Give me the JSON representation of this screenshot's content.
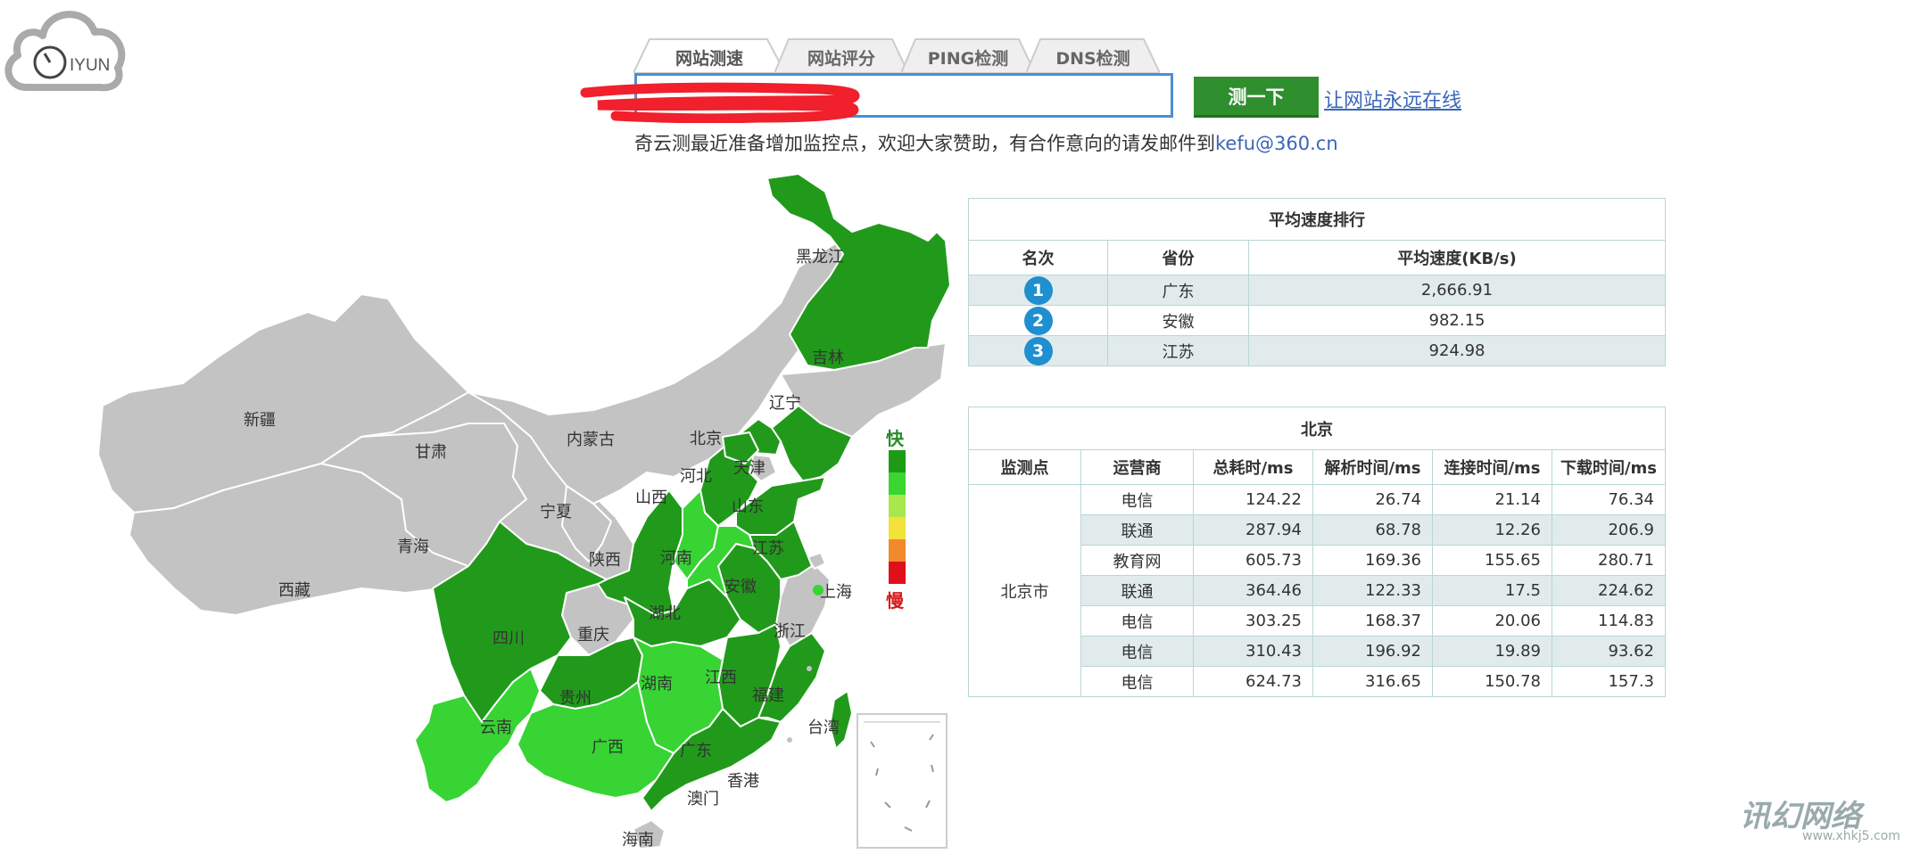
{
  "logo": {
    "text": "IYUN"
  },
  "tabs": [
    {
      "label": "网站测速",
      "active": true
    },
    {
      "label": "网站评分",
      "active": false
    },
    {
      "label": "PING检测",
      "active": false
    },
    {
      "label": "DNS检测",
      "active": false
    }
  ],
  "search": {
    "value": "",
    "redacted": true
  },
  "test_button": "测一下",
  "online_link": "让网站永远在线",
  "notice": {
    "text": "奇云测最近准备增加监控点，欢迎大家赞助，有合作意向的请发邮件到",
    "email": "kefu@360.cn"
  },
  "legend": {
    "fast": "快",
    "slow": "慢",
    "colors": [
      "#1e9b14",
      "#39d631",
      "#a8e84c",
      "#f2e23a",
      "#f08a2a",
      "#e0101a"
    ]
  },
  "colors": {
    "dark_green": "#219a1b",
    "light_green": "#37d434",
    "no_data": "#c3c3c3",
    "accent_blue": "#1f8fcf"
  },
  "map": {
    "provinces": [
      {
        "name": "新疆",
        "level": "none"
      },
      {
        "name": "西藏",
        "level": "none"
      },
      {
        "name": "青海",
        "level": "none"
      },
      {
        "name": "甘肃",
        "level": "none"
      },
      {
        "name": "内蒙古",
        "level": "none"
      },
      {
        "name": "宁夏",
        "level": "none"
      },
      {
        "name": "吉林",
        "level": "none"
      },
      {
        "name": "天津",
        "level": "none"
      },
      {
        "name": "重庆",
        "level": "none"
      },
      {
        "name": "浙江",
        "level": "none"
      },
      {
        "name": "上海",
        "level": "none"
      },
      {
        "name": "香港",
        "level": "none"
      },
      {
        "name": "澳门",
        "level": "none"
      },
      {
        "name": "海南",
        "level": "none"
      },
      {
        "name": "黑龙江",
        "level": "dark"
      },
      {
        "name": "辽宁",
        "level": "dark"
      },
      {
        "name": "北京",
        "level": "dark"
      },
      {
        "name": "河北",
        "level": "dark"
      },
      {
        "name": "山东",
        "level": "dark"
      },
      {
        "name": "江苏",
        "level": "dark"
      },
      {
        "name": "安徽",
        "level": "dark"
      },
      {
        "name": "陕西",
        "level": "dark"
      },
      {
        "name": "湖北",
        "level": "dark"
      },
      {
        "name": "四川",
        "level": "dark"
      },
      {
        "name": "贵州",
        "level": "dark"
      },
      {
        "name": "江西",
        "level": "dark"
      },
      {
        "name": "福建",
        "level": "dark"
      },
      {
        "name": "广东",
        "level": "dark"
      },
      {
        "name": "台湾",
        "level": "dark"
      },
      {
        "name": "山西",
        "level": "light"
      },
      {
        "name": "河南",
        "level": "light"
      },
      {
        "name": "湖南",
        "level": "light"
      },
      {
        "name": "云南",
        "level": "light"
      },
      {
        "name": "广西",
        "level": "light"
      }
    ]
  },
  "ranking": {
    "title": "平均速度排行",
    "headers": [
      "名次",
      "省份",
      "平均速度(KB/s)"
    ],
    "rows": [
      {
        "rank": "1",
        "province": "广东",
        "speed": "2,666.91"
      },
      {
        "rank": "2",
        "province": "安徽",
        "speed": "982.15"
      },
      {
        "rank": "3",
        "province": "江苏",
        "speed": "924.98"
      }
    ]
  },
  "detail": {
    "title": "北京",
    "headers": [
      "监测点",
      "运营商",
      "总耗时/ms",
      "解析时间/ms",
      "连接时间/ms",
      "下载时间/ms"
    ],
    "location": "北京市",
    "rows": [
      {
        "isp": "电信",
        "total": "124.22",
        "dns": "26.74",
        "connect": "21.14",
        "download": "76.34"
      },
      {
        "isp": "联通",
        "total": "287.94",
        "dns": "68.78",
        "connect": "12.26",
        "download": "206.9"
      },
      {
        "isp": "教育网",
        "total": "605.73",
        "dns": "169.36",
        "connect": "155.65",
        "download": "280.71"
      },
      {
        "isp": "联通",
        "total": "364.46",
        "dns": "122.33",
        "connect": "17.5",
        "download": "224.62"
      },
      {
        "isp": "电信",
        "total": "303.25",
        "dns": "168.37",
        "connect": "20.06",
        "download": "114.83"
      },
      {
        "isp": "电信",
        "total": "310.43",
        "dns": "196.92",
        "connect": "19.89",
        "download": "93.62"
      },
      {
        "isp": "电信",
        "total": "624.73",
        "dns": "316.65",
        "connect": "150.78",
        "download": "157.3"
      }
    ]
  },
  "watermark": {
    "brand": "讯幻网络",
    "url": "www.xhkj5.com"
  }
}
